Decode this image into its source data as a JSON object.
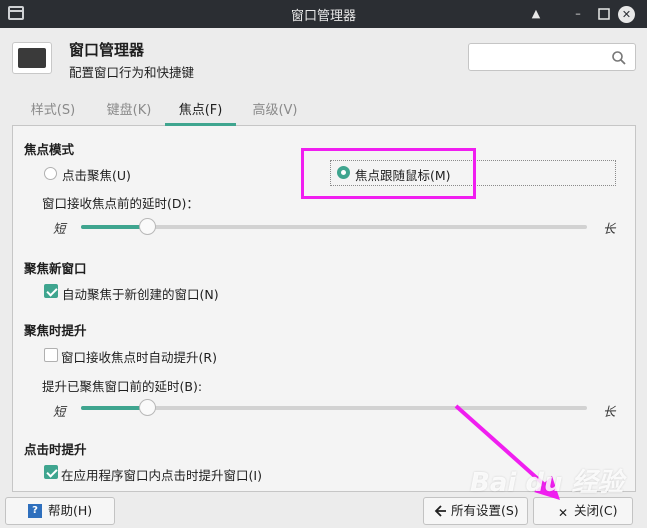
{
  "titlebar": {
    "title": "窗口管理器"
  },
  "header": {
    "title": "窗口管理器",
    "subtitle": "配置窗口行为和快捷键",
    "search_placeholder": ""
  },
  "tabs": [
    {
      "label": "样式(S)",
      "active": false
    },
    {
      "label": "键盘(K)",
      "active": false
    },
    {
      "label": "焦点(F)",
      "active": true
    },
    {
      "label": "高级(V)",
      "active": false
    }
  ],
  "focus_mode": {
    "title": "焦点模式",
    "option_click": "点击聚焦(U)",
    "option_follow": "焦点跟随鼠标(M)",
    "selected": "option_follow",
    "delay_label": "窗口接收焦点前的延时(D)：",
    "slider_min": "短",
    "slider_max": "长",
    "delay_level": 0.13
  },
  "new_window": {
    "title": "聚焦新窗口",
    "checkbox_label": "自动聚焦于新创建的窗口(N)",
    "checked": true
  },
  "raise_on_focus": {
    "title": "聚焦时提升",
    "checkbox_label": "窗口接收焦点时自动提升(R)",
    "checked": false,
    "delay_label": "提升已聚焦窗口前的延时(B):",
    "slider_min": "短",
    "slider_max": "长",
    "delay_level": 0.13
  },
  "raise_on_click": {
    "title": "点击时提升",
    "checkbox_label": "在应用程序窗口内点击时提升窗口(I)",
    "checked": true
  },
  "footer": {
    "help_label": "帮助(H)",
    "all_settings_label": "所有设置(S)",
    "close_label": "关闭(C)"
  },
  "watermark": "Bai du 经验",
  "colors": {
    "accent": "#3fa58f",
    "annotation": "#f01ef0",
    "titlebar": "#2b2e33"
  }
}
